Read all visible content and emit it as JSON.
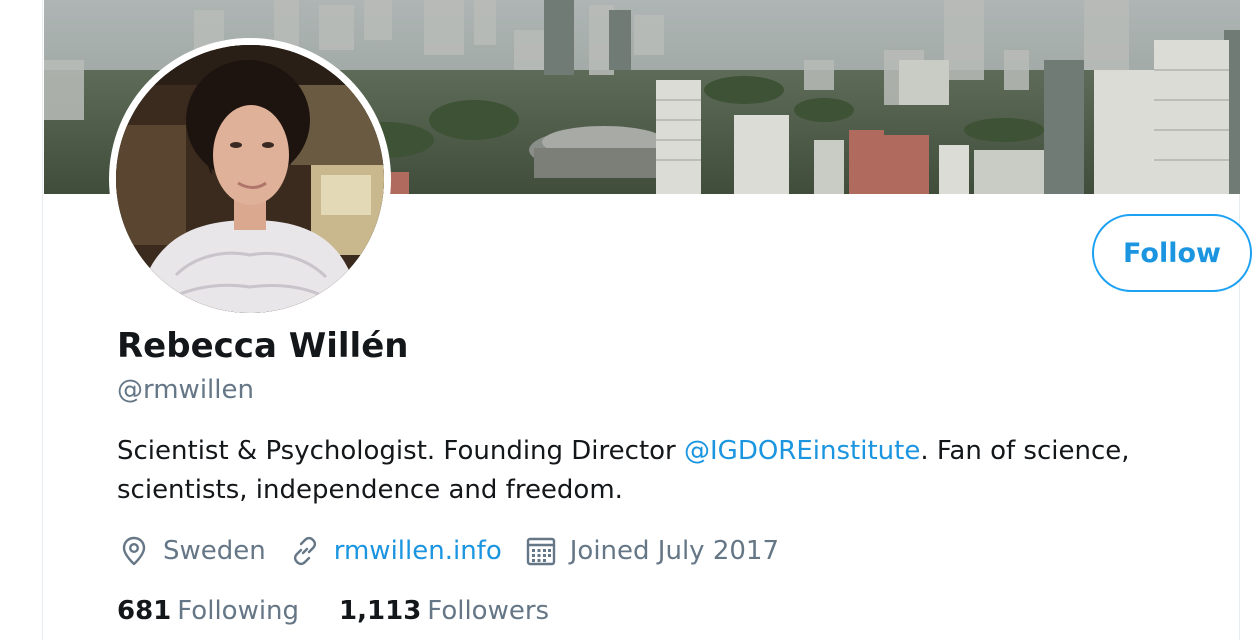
{
  "profile": {
    "display_name": "Rebecca Willén",
    "handle": "@rmwillen",
    "bio_prefix": "Scientist & Psychologist. Founding Director ",
    "bio_mention": "@IGDOREinstitute",
    "bio_suffix": ". Fan of science, scientists, independence and freedom.",
    "location": "Sweden",
    "website": "rmwillen.info",
    "joined": "Joined July 2017"
  },
  "actions": {
    "follow_label": "Follow"
  },
  "stats": {
    "following_count": "681",
    "following_label": "Following",
    "followers_count": "1,113",
    "followers_label": "Followers"
  },
  "icons": {
    "location": "location-pin-icon",
    "website": "link-icon",
    "joined": "calendar-icon"
  },
  "colors": {
    "accent": "#1da1f2",
    "link": "#1b95e0",
    "primary_text": "#14171a",
    "secondary_text": "#657786"
  }
}
